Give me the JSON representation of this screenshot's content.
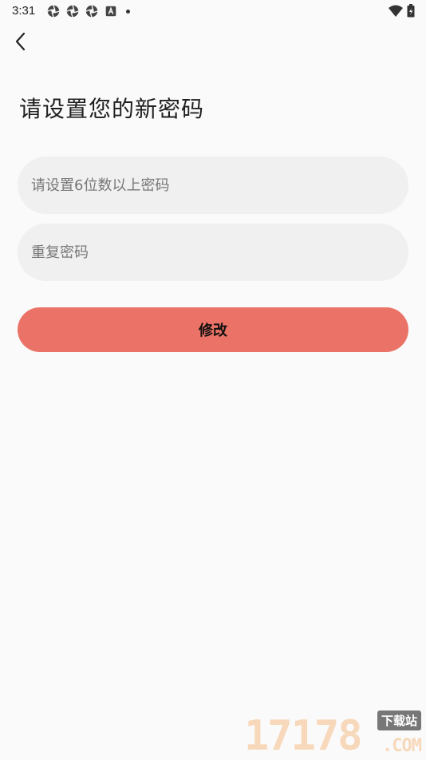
{
  "status_bar": {
    "time": "3:31"
  },
  "page": {
    "title": "请设置您的新密码"
  },
  "form": {
    "new_password_placeholder": "请设置6位数以上密码",
    "new_password_value": "",
    "confirm_password_placeholder": "重复密码",
    "confirm_password_value": "",
    "submit_label": "修改"
  },
  "watermark": {
    "digits": "17178",
    "tag": "下载站",
    "suffix": ".COM"
  },
  "colors": {
    "background": "#fafafa",
    "field_bg": "#f0f0f0",
    "button_bg": "#eb7266"
  }
}
